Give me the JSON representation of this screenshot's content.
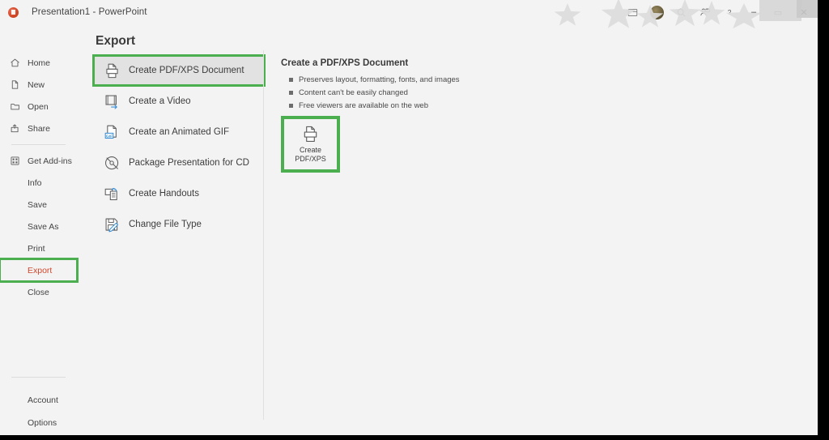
{
  "window": {
    "app_title": "Presentation1  -  PowerPoint",
    "logo_icon": "powerpoint-logo",
    "titlebar_icons": [
      "ribbon-display-options-icon",
      "user-avatar",
      "search-icon",
      "presence-icon",
      "help-icon"
    ],
    "controls": {
      "minimize": "–",
      "restore": "▭",
      "close": "✕"
    }
  },
  "backstage": {
    "back_button_icon": "back-arrow-icon",
    "page_title": "Export",
    "nav": {
      "top_items": [
        {
          "label": "Home",
          "icon": "home-icon"
        },
        {
          "label": "New",
          "icon": "new-document-icon"
        },
        {
          "label": "Open",
          "icon": "open-folder-icon"
        },
        {
          "label": "Share",
          "icon": "share-icon"
        }
      ],
      "bottom_items": [
        {
          "label": "Get Add-ins",
          "icon": "add-ins-grid-icon",
          "has_icon": true
        },
        {
          "label": "Info",
          "has_icon": false
        },
        {
          "label": "Save",
          "has_icon": false
        },
        {
          "label": "Save As",
          "has_icon": false
        },
        {
          "label": "Print",
          "has_icon": false
        },
        {
          "label": "Export",
          "has_icon": false,
          "highlighted": true
        },
        {
          "label": "Close",
          "has_icon": false
        }
      ],
      "footer_items": [
        {
          "label": "Account"
        },
        {
          "label": "Options"
        }
      ]
    },
    "options": [
      {
        "label": "Create PDF/XPS Document",
        "icon": "pdf-printer-icon",
        "selected": true
      },
      {
        "label": "Create a Video",
        "icon": "video-film-icon",
        "selected": false
      },
      {
        "label": "Create an Animated GIF",
        "icon": "animated-gif-icon",
        "selected": false
      },
      {
        "label": "Package Presentation for CD",
        "icon": "cd-disc-icon",
        "selected": false
      },
      {
        "label": "Create Handouts",
        "icon": "handouts-icon",
        "selected": false
      },
      {
        "label": "Change File Type",
        "icon": "change-file-type-icon",
        "selected": false
      }
    ],
    "detail": {
      "title": "Create a PDF/XPS Document",
      "bullets": [
        "Preserves layout, formatting, fonts, and images",
        "Content can't be easily changed",
        "Free viewers are available on the web"
      ],
      "action_button": {
        "icon": "pdf-printer-icon",
        "line1": "Create",
        "line2": "PDF/XPS"
      }
    }
  },
  "colors": {
    "highlight_green": "#4CAF4F",
    "accent_orange": "#d1472c",
    "background": "#f3f3f3",
    "selected_row": "#e2e2e2"
  }
}
